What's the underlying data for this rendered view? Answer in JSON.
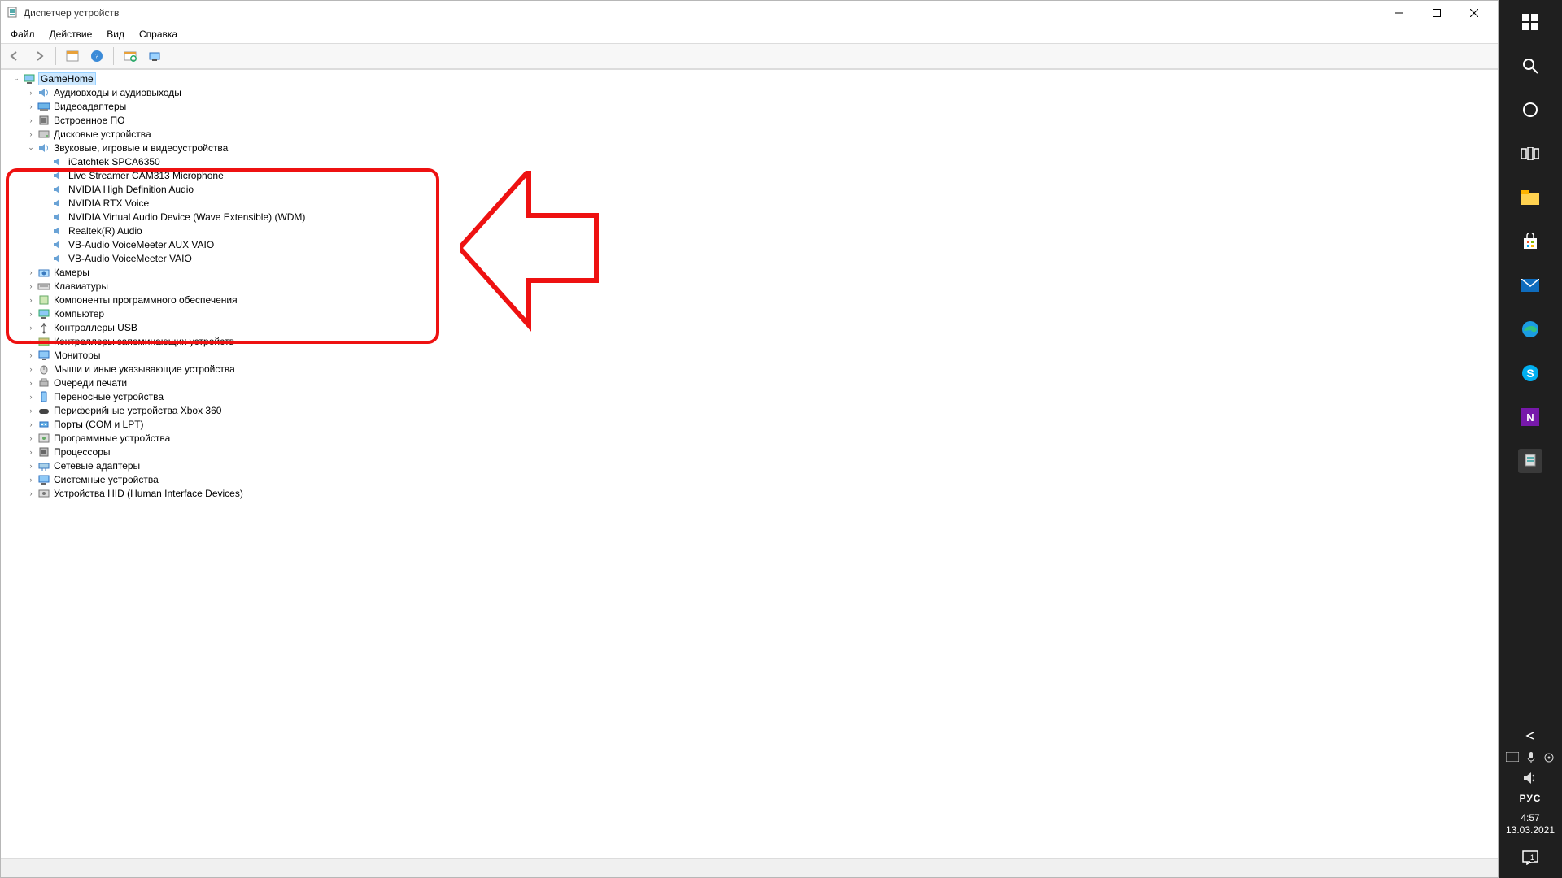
{
  "window": {
    "title": "Диспетчер устройств"
  },
  "menu": [
    "Файл",
    "Действие",
    "Вид",
    "Справка"
  ],
  "tree": {
    "root": "GameHome",
    "c0": "Аудиовходы и аудиовыходы",
    "c1": "Видеоадаптеры",
    "c2": "Встроенное ПО",
    "c3": "Дисковые устройства",
    "c4": "Звуковые, игровые и видеоустройства",
    "c4_0": "iCatchtek SPCA6350",
    "c4_1": "Live Streamer CAM313 Microphone",
    "c4_2": "NVIDIA High Definition Audio",
    "c4_3": "NVIDIA RTX Voice",
    "c4_4": "NVIDIA Virtual Audio Device (Wave Extensible) (WDM)",
    "c4_5": "Realtek(R) Audio",
    "c4_6": "VB-Audio VoiceMeeter AUX VAIO",
    "c4_7": "VB-Audio VoiceMeeter VAIO",
    "c5": "Камеры",
    "c6": "Клавиатуры",
    "c7": "Компоненты программного обеспечения",
    "c8": "Компьютер",
    "c9": "Контроллеры USB",
    "c10": "Контроллеры запоминающих устройств",
    "c11": "Мониторы",
    "c12": "Мыши и иные указывающие устройства",
    "c13": "Очереди печати",
    "c14": "Переносные устройства",
    "c15": "Периферийные устройства Xbox 360",
    "c16": "Порты (COM и LPT)",
    "c17": "Программные устройства",
    "c18": "Процессоры",
    "c19": "Сетевые адаптеры",
    "c20": "Системные устройства",
    "c21": "Устройства HID (Human Interface Devices)"
  },
  "taskbar": {
    "lang": "РУС",
    "time": "4:57",
    "date": "13.03.2021",
    "notif_count": "1"
  }
}
